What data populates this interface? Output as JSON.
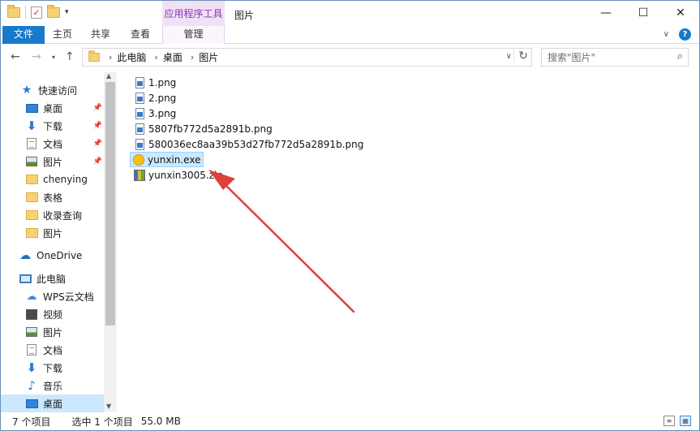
{
  "title_bar": {
    "context_tab": "应用程序工具",
    "window_title": "图片",
    "minimize": "—",
    "maximize": "☐",
    "close": "✕"
  },
  "ribbon": {
    "file": "文件",
    "home": "主页",
    "share": "共享",
    "view": "查看",
    "manage": "管理"
  },
  "address": {
    "crumbs": [
      "此电脑",
      "桌面",
      "图片"
    ],
    "search_placeholder": "搜索\"图片\""
  },
  "nav": {
    "quick_access": "快速访问",
    "quick_items": [
      {
        "label": "桌面",
        "icon": "desktop-icon"
      },
      {
        "label": "下载",
        "icon": "download-icon"
      },
      {
        "label": "文档",
        "icon": "document-icon"
      },
      {
        "label": "图片",
        "icon": "picture-icon"
      },
      {
        "label": "chenying",
        "icon": "folder-icon"
      },
      {
        "label": "表格",
        "icon": "folder-icon"
      },
      {
        "label": "收录查询",
        "icon": "folder-icon"
      },
      {
        "label": "图片",
        "icon": "folder-icon"
      }
    ],
    "onedrive": "OneDrive",
    "this_pc": "此电脑",
    "pc_items": [
      {
        "label": "WPS云文档",
        "icon": "wps-cloud-icon"
      },
      {
        "label": "视频",
        "icon": "video-icon"
      },
      {
        "label": "图片",
        "icon": "picture-icon"
      },
      {
        "label": "文档",
        "icon": "document-icon"
      },
      {
        "label": "下载",
        "icon": "download-icon"
      },
      {
        "label": "音乐",
        "icon": "music-icon"
      },
      {
        "label": "桌面",
        "icon": "desktop-icon"
      }
    ]
  },
  "files": [
    {
      "name": "1.png",
      "icon": "png-file-icon"
    },
    {
      "name": "2.png",
      "icon": "png-file-icon"
    },
    {
      "name": "3.png",
      "icon": "png-file-icon"
    },
    {
      "name": "5807fb772d5a2891b.png",
      "icon": "png-file-icon"
    },
    {
      "name": "580036ec8aa39b53d27fb772d5a2891b.png",
      "icon": "png-file-icon"
    },
    {
      "name": "yunxin.exe",
      "icon": "exe-file-icon",
      "selected": true
    },
    {
      "name": "yunxin3005.zip",
      "icon": "zip-file-icon"
    }
  ],
  "status": {
    "count": "7 个项目",
    "selected": "选中 1 个项目",
    "size": "55.0 MB"
  },
  "colors": {
    "accent": "#1979ca",
    "selection": "#cce8ff",
    "context_tab": "#f0e1f7",
    "annotation_arrow": "#e0403a"
  }
}
